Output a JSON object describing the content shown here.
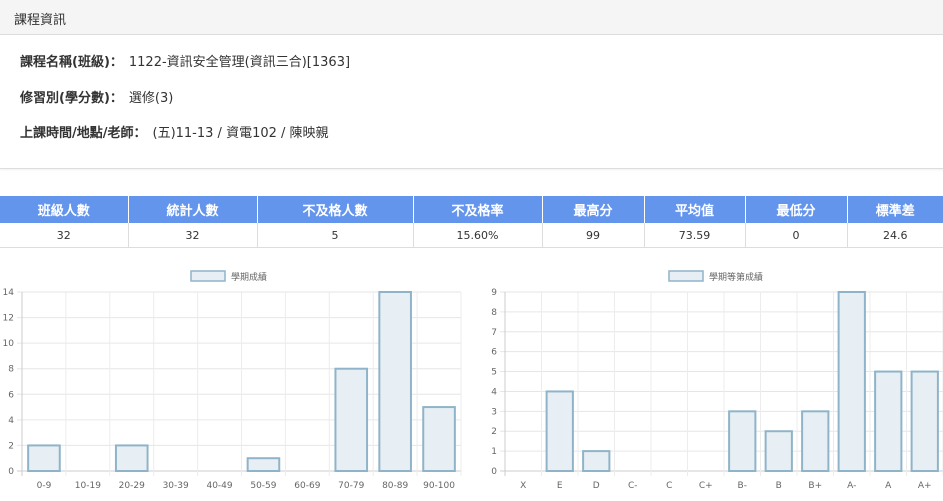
{
  "panel": {
    "title": "課程資訊"
  },
  "info": {
    "course_label": "課程名稱(班級)：",
    "course_value": "1122-資訊安全管理(資訊三合)[1363]",
    "type_label": "修習別(學分數)：",
    "type_value": "選修(3)",
    "time_label": "上課時間/地點/老師：",
    "time_value": "(五)11-13 / 資電102 / 陳映親"
  },
  "stats": {
    "headers": [
      "班級人數",
      "統計人數",
      "不及格人數",
      "不及格率",
      "最高分",
      "平均值",
      "最低分",
      "標準差"
    ],
    "values": [
      "32",
      "32",
      "5",
      "15.60%",
      "99",
      "73.59",
      "0",
      "24.6"
    ]
  },
  "colors": {
    "header_bg": "#6495ed",
    "bar_fill": "#e8eff4",
    "bar_stroke": "#8fb4c9"
  },
  "chart_data": [
    {
      "type": "bar",
      "legend": "學期成績",
      "legend_position": "top",
      "categories": [
        "0-9",
        "10-19",
        "20-29",
        "30-39",
        "40-49",
        "50-59",
        "60-69",
        "70-79",
        "80-89",
        "90-100"
      ],
      "values": [
        2,
        0,
        2,
        0,
        0,
        1,
        0,
        8,
        14,
        5
      ],
      "ylim": [
        0,
        14
      ],
      "yticks": [
        0,
        2,
        4,
        6,
        8,
        10,
        12,
        14
      ],
      "grid": true
    },
    {
      "type": "bar",
      "legend": "學期等第成績",
      "legend_position": "top",
      "categories": [
        "X",
        "E",
        "D",
        "C-",
        "C",
        "C+",
        "B-",
        "B",
        "B+",
        "A-",
        "A",
        "A+"
      ],
      "values": [
        0,
        4,
        1,
        0,
        0,
        0,
        3,
        2,
        3,
        9,
        5,
        5
      ],
      "ylim": [
        0,
        9
      ],
      "yticks": [
        0,
        1,
        2,
        3,
        4,
        5,
        6,
        7,
        8,
        9
      ],
      "grid": true
    }
  ]
}
